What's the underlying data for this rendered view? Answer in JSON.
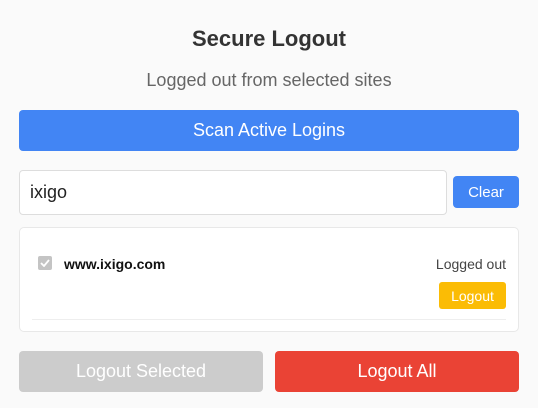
{
  "header": {
    "title": "Secure Logout",
    "subtitle": "Logged out from selected sites"
  },
  "actions": {
    "scan_label": "Scan Active Logins",
    "logout_selected_label": "Logout Selected",
    "logout_all_label": "Logout All"
  },
  "search": {
    "value": "ixigo",
    "clear_label": "Clear"
  },
  "sites": [
    {
      "name": "www.ixigo.com",
      "status": "Logged out",
      "checked": true,
      "disabled": true,
      "button_label": "Logout"
    }
  ],
  "colors": {
    "primary": "#4285f4",
    "danger": "#ea4335",
    "warning": "#fbbc05",
    "disabled": "#cccccc"
  }
}
